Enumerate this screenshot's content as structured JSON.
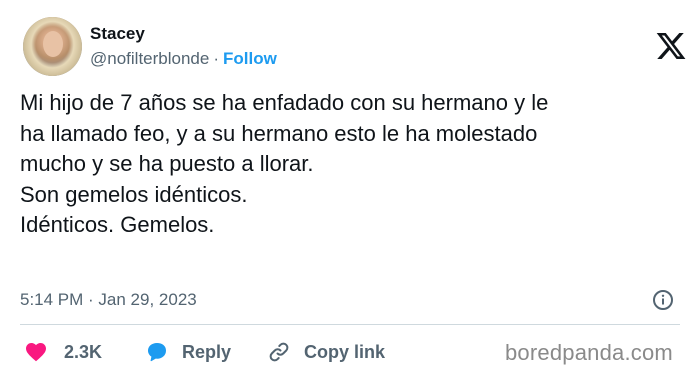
{
  "author": {
    "display_name": "Stacey",
    "handle": "@nofilterblonde",
    "separator": "·",
    "follow_label": "Follow"
  },
  "tweet": {
    "lines": [
      "Mi hijo de 7 años se ha enfadado con su hermano y le",
      "ha llamado feo, y a su hermano esto le ha molestado",
      "mucho y se ha puesto a llorar.",
      "Son gemelos idénticos.",
      "Idénticos. Gemelos."
    ],
    "timestamp": "5:14 PM · Jan 29, 2023"
  },
  "actions": {
    "likes": "2.3K",
    "reply_label": "Reply",
    "copy_link_label": "Copy link"
  },
  "watermark": "boredpanda.com",
  "colors": {
    "accent": "#1d9bf0",
    "like": "#f91880",
    "text": "#0f1419",
    "secondary": "#536471"
  },
  "icons": [
    "x-logo-icon",
    "info-icon",
    "heart-icon",
    "reply-bubble-icon",
    "link-icon"
  ]
}
